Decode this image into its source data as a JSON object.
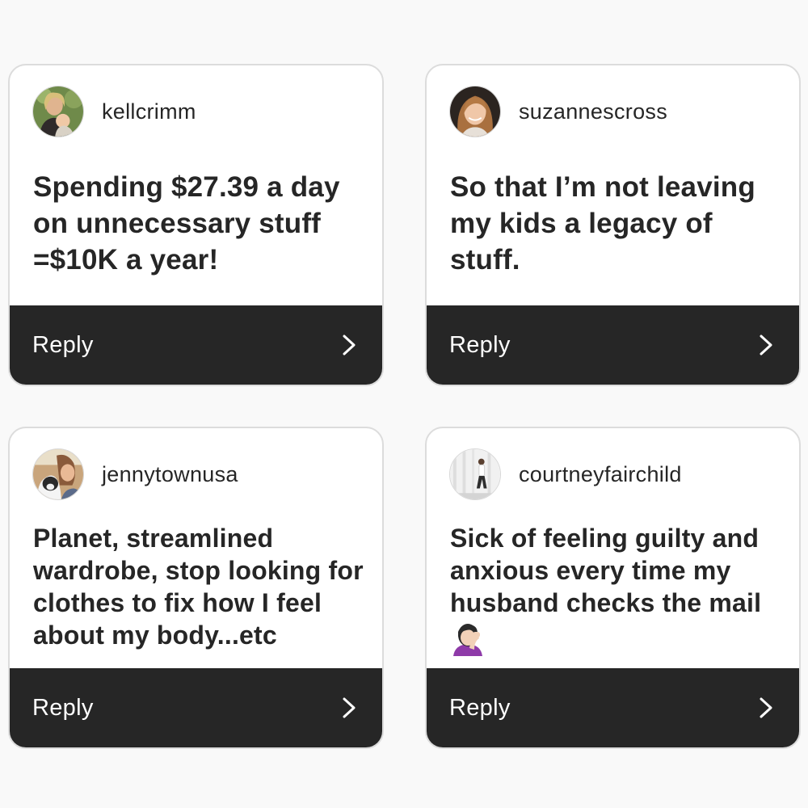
{
  "cards": [
    {
      "username": "kellcrimm",
      "avatar_icon": "profile-photo-woman-with-baby",
      "message": "Spending $27.39 a day on unnecessary stuff =$10K a year!",
      "reply_label": "Reply"
    },
    {
      "username": "suzannescross",
      "avatar_icon": "profile-photo-woman-smiling",
      "message": "So that I’m not leaving my kids a legacy of stuff.",
      "reply_label": "Reply"
    },
    {
      "username": "jennytownusa",
      "avatar_icon": "profile-photo-woman-with-dog",
      "message": "Planet, streamlined wardrobe, stop looking for clothes to fix how I feel about my body...etc",
      "reply_label": "Reply"
    },
    {
      "username": "courtneyfairchild",
      "avatar_icon": "profile-photo-woman-by-white-wall",
      "message": "Sick of feeling guilty and anxious every time my husband checks the mail",
      "emoji": "face-palm-emoji",
      "reply_label": "Reply"
    }
  ],
  "colors": {
    "background": "#f9f9f9",
    "card": "#ffffff",
    "reply_bar": "#262626",
    "text": "#262626"
  }
}
